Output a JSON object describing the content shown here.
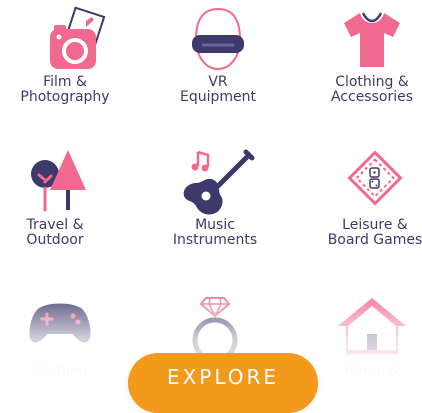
{
  "categories": [
    {
      "label": "Film &\nPhotography",
      "icon": "camera-icon"
    },
    {
      "label": "VR\nEquipment",
      "icon": "vr-headset-icon"
    },
    {
      "label": "Clothing &\nAccessories",
      "icon": "tshirt-icon"
    },
    {
      "label": "Travel &\nOutdoor",
      "icon": "trees-icon"
    },
    {
      "label": "Music\nInstruments",
      "icon": "guitar-icon"
    },
    {
      "label": "Leisure &\nBoard Games",
      "icon": "board-game-icon"
    },
    {
      "label": "Gaming",
      "icon": "gamepad-icon"
    },
    {
      "label": "",
      "icon": "ring-icon"
    },
    {
      "label": "Home &",
      "icon": "house-icon"
    }
  ],
  "explore_label": "EXPLORE",
  "colors": {
    "navy": "#3d3a6b",
    "pink": "#f06a8f",
    "orange": "#f39a1c"
  }
}
